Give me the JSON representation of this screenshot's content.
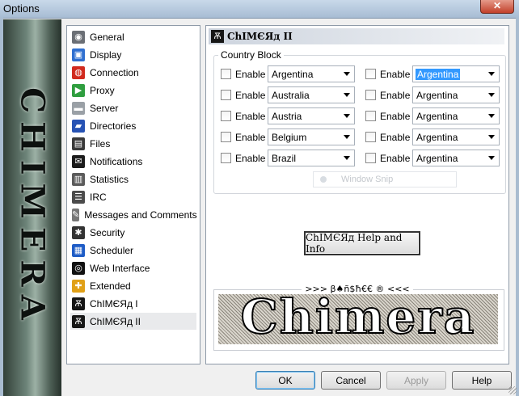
{
  "window": {
    "title": "Options",
    "close_glyph": "✕"
  },
  "banner": {
    "text": "CHIMERA"
  },
  "sidebar": {
    "items": [
      {
        "label": "General",
        "icon": "general-icon",
        "glyph": "◉"
      },
      {
        "label": "Display",
        "icon": "display-icon",
        "glyph": "▣"
      },
      {
        "label": "Connection",
        "icon": "connection-icon",
        "glyph": "◍"
      },
      {
        "label": "Proxy",
        "icon": "proxy-icon",
        "glyph": "▶"
      },
      {
        "label": "Server",
        "icon": "server-icon",
        "glyph": "▬"
      },
      {
        "label": "Directories",
        "icon": "directories-icon",
        "glyph": "▰"
      },
      {
        "label": "Files",
        "icon": "files-icon",
        "glyph": "▤"
      },
      {
        "label": "Notifications",
        "icon": "notifications-icon",
        "glyph": "✉"
      },
      {
        "label": "Statistics",
        "icon": "statistics-icon",
        "glyph": "▥"
      },
      {
        "label": "IRC",
        "icon": "irc-icon",
        "glyph": "☰"
      },
      {
        "label": "Messages and Comments",
        "icon": "messages-icon",
        "glyph": "✎"
      },
      {
        "label": "Security",
        "icon": "security-icon",
        "glyph": "✱"
      },
      {
        "label": "Scheduler",
        "icon": "scheduler-icon",
        "glyph": "▦"
      },
      {
        "label": "Web Interface",
        "icon": "web-interface-icon",
        "glyph": "◎"
      },
      {
        "label": "Extended",
        "icon": "extended-icon",
        "glyph": "✚"
      },
      {
        "label": "ChIMЄЯд I",
        "icon": "chimera-icon",
        "glyph": "Ѫ"
      },
      {
        "label": "ChIMЄЯд II",
        "icon": "chimera-icon",
        "glyph": "Ѫ",
        "selected": true
      }
    ]
  },
  "panel": {
    "title": "ChIMЄЯд II",
    "country_block": {
      "label": "Country Block",
      "enable_label": "Enable",
      "left_column": [
        "Argentina",
        "Australia",
        "Austria",
        "Belgium",
        "Brazil"
      ],
      "right_column": [
        "Argentina",
        "Argentina",
        "Argentina",
        "Argentina",
        "Argentina"
      ],
      "right_first_highlighted": true
    },
    "ghost_text": "Window Snip",
    "help_button": "ChIMЄЯд Help and Info",
    "logo": {
      "caption": ">>>  β♠ñ$ħ€€ ®  <<<",
      "text": "Chimera",
      "mark": "®"
    }
  },
  "buttons": {
    "ok": "OK",
    "cancel": "Cancel",
    "apply": "Apply",
    "help": "Help"
  },
  "colors": {
    "accent": "#3399ff",
    "selected_item": "#e9eaec",
    "title_bar": "#b8cbe0"
  }
}
